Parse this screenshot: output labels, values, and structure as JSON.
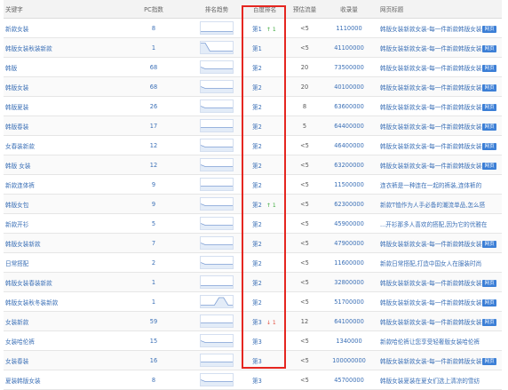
{
  "columns": {
    "keyword": "关键字",
    "pc_index": "PC指数",
    "trend": "排名趋势",
    "rank": "百度排名",
    "traffic": "预估流量",
    "indexed": "收录量",
    "page_title": "网页标题"
  },
  "badge_label": "网页",
  "highlight_color": "#e52620",
  "rows": [
    {
      "keyword": "新款女装",
      "pc": "8",
      "trend": [
        0.1,
        0.1,
        0.1,
        0.1,
        0.1,
        0.1,
        0.1,
        0.1
      ],
      "rank": "第1",
      "change_dir": "up",
      "change": "1",
      "traffic": "<5",
      "indexed": "1110000",
      "title": "韩版女装新款女装-每一件新款韩版女装",
      "badge": true
    },
    {
      "keyword": "韩版女装秋装新款",
      "pc": "1",
      "trend": [
        1,
        1,
        0.1,
        0.1,
        0.1,
        0.1,
        0.1,
        0.1
      ],
      "rank": "第1",
      "change_dir": "",
      "change": "",
      "traffic": "<5",
      "indexed": "41100000",
      "title": "韩版女装新款女装-每一件新款韩版女装",
      "badge": true
    },
    {
      "keyword": "韩版",
      "pc": "68",
      "trend": [
        0.5,
        0.3,
        0.3,
        0.3,
        0.3,
        0.3,
        0.3,
        0.3
      ],
      "rank": "第2",
      "change_dir": "",
      "change": "",
      "traffic": "20",
      "indexed": "73500000",
      "title": "韩版女装新款女装-每一件新款韩版女装",
      "badge": true
    },
    {
      "keyword": "韩版女装",
      "pc": "68",
      "trend": [
        0.5,
        0.3,
        0.3,
        0.3,
        0.3,
        0.3,
        0.3,
        0.3
      ],
      "rank": "第2",
      "change_dir": "",
      "change": "",
      "traffic": "20",
      "indexed": "40100000",
      "title": "韩版女装新款女装-每一件新款韩版女装",
      "badge": true
    },
    {
      "keyword": "韩版夏装",
      "pc": "26",
      "trend": [
        0.5,
        0.3,
        0.3,
        0.3,
        0.3,
        0.3,
        0.3,
        0.3
      ],
      "rank": "第2",
      "change_dir": "",
      "change": "",
      "traffic": "8",
      "indexed": "63600000",
      "title": "韩版女装新款女装-每一件新款韩版女装",
      "badge": true
    },
    {
      "keyword": "韩版春装",
      "pc": "17",
      "trend": [
        0.3,
        0.3,
        0.3,
        0.3,
        0.3,
        0.3,
        0.3,
        0.3
      ],
      "rank": "第2",
      "change_dir": "",
      "change": "",
      "traffic": "5",
      "indexed": "64400000",
      "title": "韩版女装新款女装-每一件新款韩版女装",
      "badge": true
    },
    {
      "keyword": "女春装新款",
      "pc": "12",
      "trend": [
        0.5,
        0.3,
        0.3,
        0.3,
        0.3,
        0.3,
        0.3,
        0.3
      ],
      "rank": "第2",
      "change_dir": "",
      "change": "",
      "traffic": "<5",
      "indexed": "46400000",
      "title": "韩版女装新款女装-每一件新款韩版女装",
      "badge": true
    },
    {
      "keyword": "韩版 女装",
      "pc": "12",
      "trend": [
        0.5,
        0.3,
        0.3,
        0.3,
        0.3,
        0.3,
        0.3,
        0.3
      ],
      "rank": "第2",
      "change_dir": "",
      "change": "",
      "traffic": "<5",
      "indexed": "63200000",
      "title": "韩版女装新款女装-每一件新款韩版女装",
      "badge": true
    },
    {
      "keyword": "新款连体裤",
      "pc": "9",
      "trend": [
        0.3,
        0.3,
        0.3,
        0.3,
        0.3,
        0.3,
        0.3,
        0.3
      ],
      "rank": "第2",
      "change_dir": "",
      "change": "",
      "traffic": "<5",
      "indexed": "11500000",
      "title": "连衣裤是一种连在一起的裤装,连体裤的",
      "badge": false
    },
    {
      "keyword": "韩版女包",
      "pc": "9",
      "trend": [
        0.5,
        0.3,
        0.3,
        0.3,
        0.3,
        0.3,
        0.3,
        0.3
      ],
      "rank": "第2",
      "change_dir": "up",
      "change": "1",
      "traffic": "<5",
      "indexed": "62300000",
      "title": "新款T恤作为人手必备的潮流单品,怎么搭",
      "badge": false
    },
    {
      "keyword": "新款开衫",
      "pc": "5",
      "trend": [
        0.5,
        0.3,
        0.3,
        0.3,
        0.3,
        0.3,
        0.3,
        0.3
      ],
      "rank": "第2",
      "change_dir": "",
      "change": "",
      "traffic": "<5",
      "indexed": "45900000",
      "title": "...开衫那多人喜欢的搭配,因为它的优雅在",
      "badge": false
    },
    {
      "keyword": "韩版女装新款",
      "pc": "7",
      "trend": [
        0.5,
        0.3,
        0.3,
        0.3,
        0.3,
        0.3,
        0.3,
        0.3
      ],
      "rank": "第2",
      "change_dir": "",
      "change": "",
      "traffic": "<5",
      "indexed": "47900000",
      "title": "韩版女装新款女装-每一件新款韩版女装",
      "badge": true
    },
    {
      "keyword": "日常搭配",
      "pc": "2",
      "trend": [
        0.5,
        0.3,
        0.3,
        0.3,
        0.3,
        0.3,
        0.3,
        0.3
      ],
      "rank": "第2",
      "change_dir": "",
      "change": "",
      "traffic": "<5",
      "indexed": "11600000",
      "title": "新款日常搭配,打造中国女人在服装时尚",
      "badge": false
    },
    {
      "keyword": "韩版女装春装新款",
      "pc": "1",
      "trend": [
        0.1,
        0.1,
        0.1,
        0.1,
        0.1,
        0.1,
        0.1,
        0.1
      ],
      "rank": "第2",
      "change_dir": "",
      "change": "",
      "traffic": "<5",
      "indexed": "32800000",
      "title": "韩版女装新款女装-每一件新款韩版女装",
      "badge": true
    },
    {
      "keyword": "韩版女装秋冬装新款",
      "pc": "1",
      "trend": [
        0.1,
        0.1,
        0.1,
        0.1,
        0.95,
        0.95,
        0.1,
        0.1
      ],
      "rank": "第2",
      "change_dir": "",
      "change": "",
      "traffic": "<5",
      "indexed": "51700000",
      "title": "韩版女装新款女装-每一件新款韩版女装",
      "badge": true
    },
    {
      "keyword": "女装新款",
      "pc": "59",
      "trend": [
        0.3,
        0.3,
        0.3,
        0.3,
        0.3,
        0.3,
        0.3,
        0.3
      ],
      "rank": "第3",
      "change_dir": "down",
      "change": "1",
      "traffic": "12",
      "indexed": "64100000",
      "title": "韩版女装新款女装-每一件新款韩版女装",
      "badge": true
    },
    {
      "keyword": "女装哈伦裤",
      "pc": "15",
      "trend": [
        0.5,
        0.3,
        0.3,
        0.3,
        0.3,
        0.3,
        0.3,
        0.3
      ],
      "rank": "第3",
      "change_dir": "",
      "change": "",
      "traffic": "<5",
      "indexed": "1340000",
      "title": "新款哈伦裤让您享受轻奢版女装哈伦裤",
      "badge": false
    },
    {
      "keyword": "女装春装",
      "pc": "16",
      "trend": [
        0.3,
        0.3,
        0.3,
        0.3,
        0.3,
        0.3,
        0.3,
        0.3
      ],
      "rank": "第3",
      "change_dir": "",
      "change": "",
      "traffic": "<5",
      "indexed": "100000000",
      "title": "韩版女装新款女装-每一件新款韩版女装",
      "badge": true
    },
    {
      "keyword": "夏装韩版女装",
      "pc": "8",
      "trend": [
        0.5,
        0.3,
        0.3,
        0.3,
        0.3,
        0.3,
        0.3,
        0.3
      ],
      "rank": "第3",
      "change_dir": "",
      "change": "",
      "traffic": "<5",
      "indexed": "45700000",
      "title": "韩版女装夏装在夏女们选上清凉的雪纺",
      "badge": false
    }
  ]
}
